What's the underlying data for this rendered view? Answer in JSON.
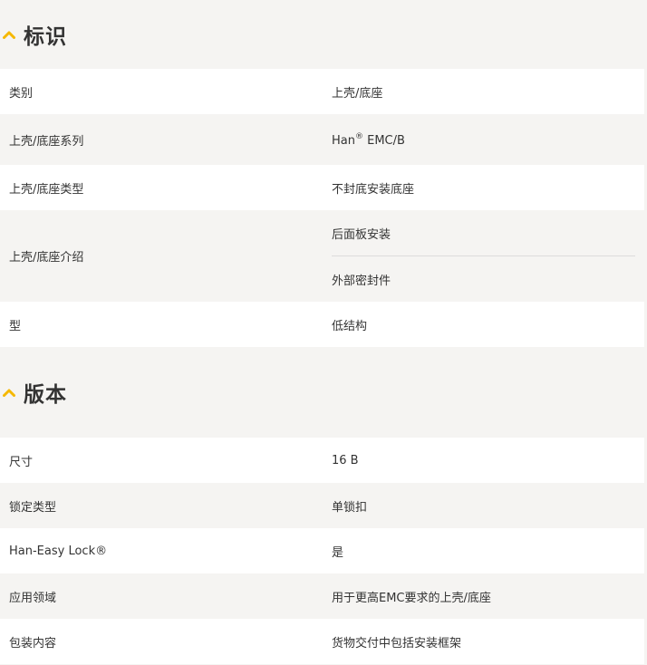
{
  "section_identification": {
    "title": "标识",
    "rows": [
      {
        "label": "类别",
        "value": "上壳/底座"
      },
      {
        "label": "上壳/底座系列",
        "value_prefix": "Han",
        "value_reg": "®",
        "value_suffix": " EMC/B"
      },
      {
        "label": "上壳/底座类型",
        "value": "不封底安装底座"
      },
      {
        "label": "上壳/底座介绍",
        "values": [
          "后面板安装",
          "外部密封件"
        ]
      },
      {
        "label": "型",
        "value": "低结构"
      }
    ]
  },
  "section_version": {
    "title": "版本",
    "rows": [
      {
        "label": "尺寸",
        "value": "16 B"
      },
      {
        "label": "锁定类型",
        "value": "单锁扣"
      },
      {
        "label": "Han-Easy Lock®",
        "value": "是"
      },
      {
        "label": "应用领域",
        "value": "用于更高EMC要求的上壳/底座"
      },
      {
        "label": "包装内容",
        "value": "货物交付中包括安装框架"
      }
    ]
  },
  "colors": {
    "accent": "#f5b800",
    "background": "#f5f4f2",
    "row_white": "#ffffff",
    "text": "#333333"
  },
  "icons": {
    "section_toggle": "chevron-up-icon"
  }
}
